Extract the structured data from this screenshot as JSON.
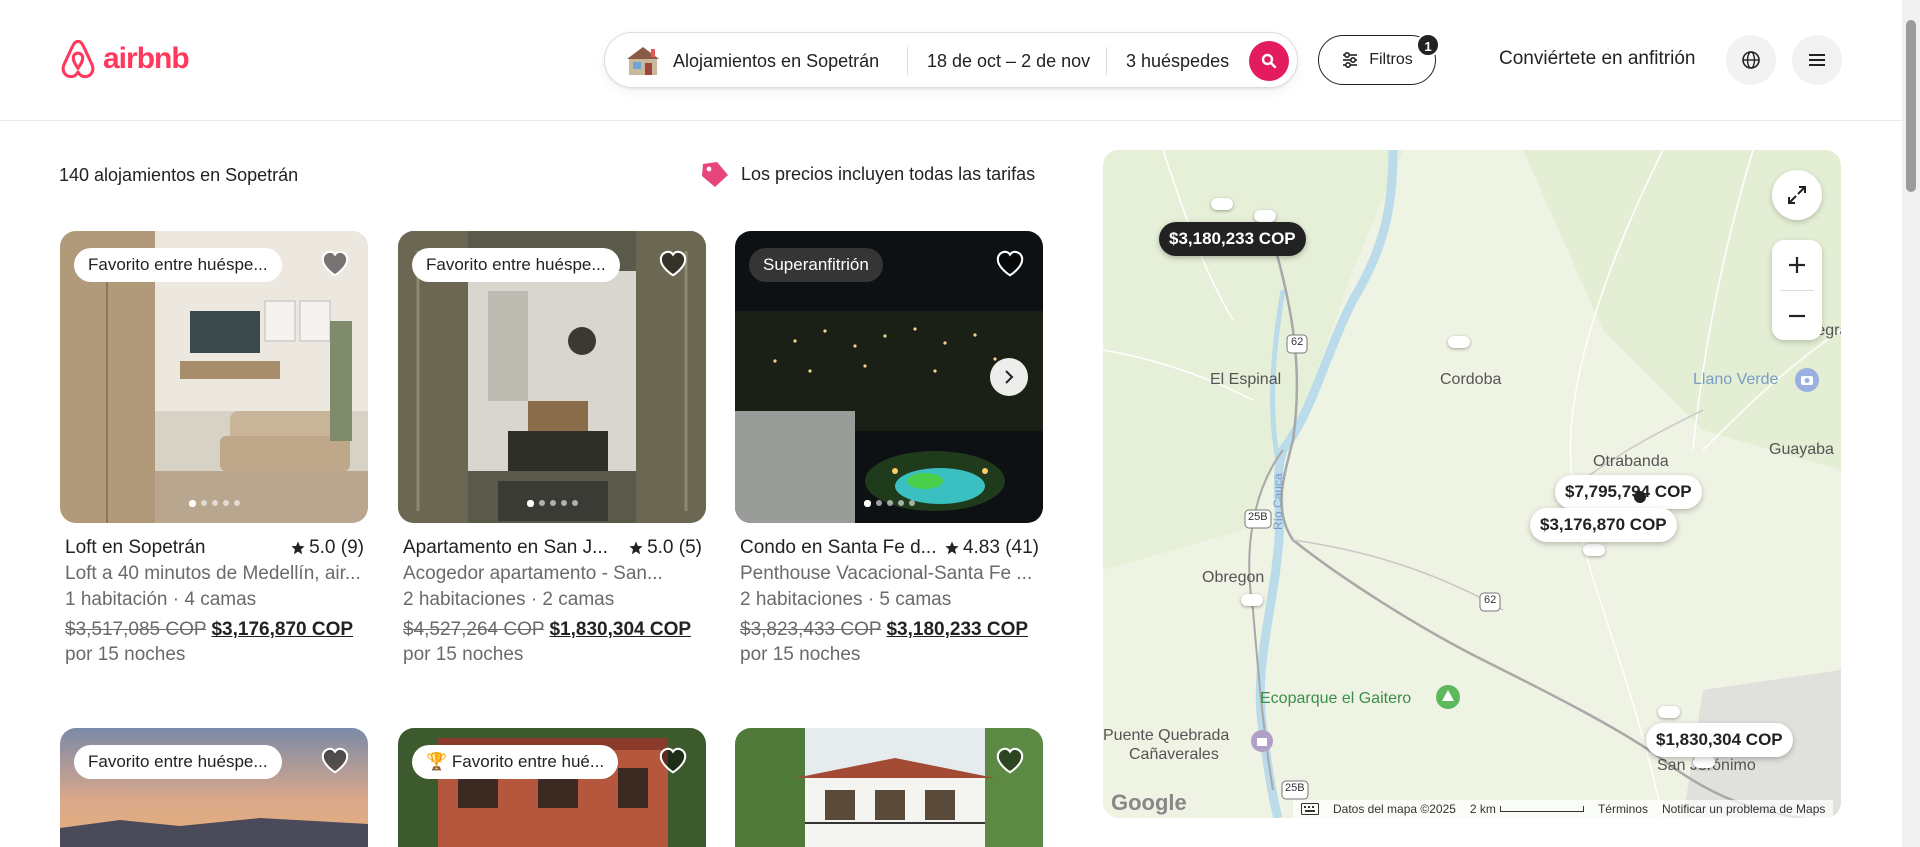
{
  "header": {
    "logo_text": "airbnb",
    "search": {
      "location": "Alojamientos en Sopetrán",
      "dates": "18 de oct – 2 de nov",
      "guests": "3 huéspedes"
    },
    "filters_label": "Filtros",
    "filters_count": "1",
    "host_link": "Conviértete en anfitrión"
  },
  "results": {
    "count_text": "140 alojamientos en Sopetrán",
    "price_note": "Los precios incluyen todas las tarifas"
  },
  "listings": [
    {
      "badge": "Favorito entre huéspe...",
      "title": "Loft en Sopetrán",
      "rating": "5.0 (9)",
      "desc": "Loft a 40 minutos de Medellín, air...",
      "beds": "1 habitación · 4 camas",
      "old_price": "$3,517,085 COP",
      "new_price": "$3,176,870 COP",
      "nights": "por 15 noches"
    },
    {
      "badge": "Favorito entre huéspe...",
      "title": "Apartamento en San J...",
      "rating": "5.0 (5)",
      "desc": "Acogedor apartamento - San...",
      "beds": "2 habitaciones · 2 camas",
      "old_price": "$4,527,264 COP",
      "new_price": "$1,830,304 COP",
      "nights": "por 15 noches"
    },
    {
      "badge": "Superanfitrión",
      "title": "Condo en Santa Fe d...",
      "rating": "4.83 (41)",
      "desc": "Penthouse Vacacional-Santa Fe ...",
      "beds": "2 habitaciones · 5 camas",
      "old_price": "$3,823,433 COP",
      "new_price": "$3,180,233 COP",
      "nights": "por 15 noches"
    },
    {
      "badge": "Favorito entre huéspe..."
    },
    {
      "badge": "Favorito entre hué..."
    },
    {
      "badge": ""
    }
  ],
  "map": {
    "labels": {
      "el_espinal": "El Espinal",
      "cordoba": "Cordoba",
      "llano_verde": "Llano Verde",
      "otrabanda": "Otrabanda",
      "guayaba": "Guayaba",
      "obregon": "Obregon",
      "rio_cauca": "Río Cauca",
      "ecoparque": "Ecoparque el Gaitero",
      "puente_quebrada": "Puente Quebrada",
      "canaverales": "Cañaverales",
      "san_jeronimo": "San Jerónimo",
      "megra": "Megra",
      "route_62a": "62",
      "route_62b": "62",
      "route_25b_a": "25B",
      "route_25b_b": "25B"
    },
    "price_pins": {
      "pin_a": "$3,180,233 COP",
      "pin_b": "$7,795,794 COP",
      "pin_c": "$3,176,870 COP",
      "pin_d": "$1,830,304 COP"
    },
    "google_logo": "Google",
    "attribution": {
      "data": "Datos del mapa ©2025",
      "scale": "2 km",
      "terms": "Términos",
      "report": "Notificar un problema de Maps"
    }
  }
}
